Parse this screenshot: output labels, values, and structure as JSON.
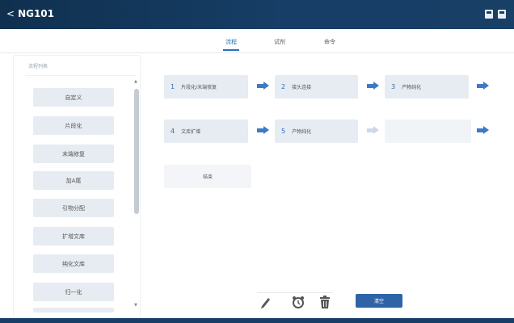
{
  "header": {
    "back_label": "NG101",
    "icons": [
      "save-icon",
      "save-all-icon"
    ]
  },
  "tabs": [
    {
      "label": "流程",
      "active": true
    },
    {
      "label": "试剂",
      "active": false
    },
    {
      "label": "命令",
      "active": false
    }
  ],
  "sidebar": {
    "title": "流程列表",
    "items": [
      {
        "label": "自定义"
      },
      {
        "label": "片段化"
      },
      {
        "label": "末端修复"
      },
      {
        "label": "加A尾"
      },
      {
        "label": "引物分配"
      },
      {
        "label": "扩增文库"
      },
      {
        "label": "纯化文库"
      },
      {
        "label": "归一化"
      }
    ]
  },
  "steps": [
    {
      "num": "1",
      "label": "片段化/末端修复"
    },
    {
      "num": "2",
      "label": "接头连接"
    },
    {
      "num": "3",
      "label": "产物纯化"
    },
    {
      "num": "4",
      "label": "文库扩增"
    },
    {
      "num": "5",
      "label": "产物纯化"
    },
    {
      "num": "",
      "label": ""
    }
  ],
  "end_label": "结束",
  "toolbar": {
    "clear_label": "清空"
  },
  "colors": {
    "header_bg": "#163e66",
    "accent": "#2a6fbd",
    "arrow": "#3e7ac4",
    "button": "#2f63a8"
  }
}
